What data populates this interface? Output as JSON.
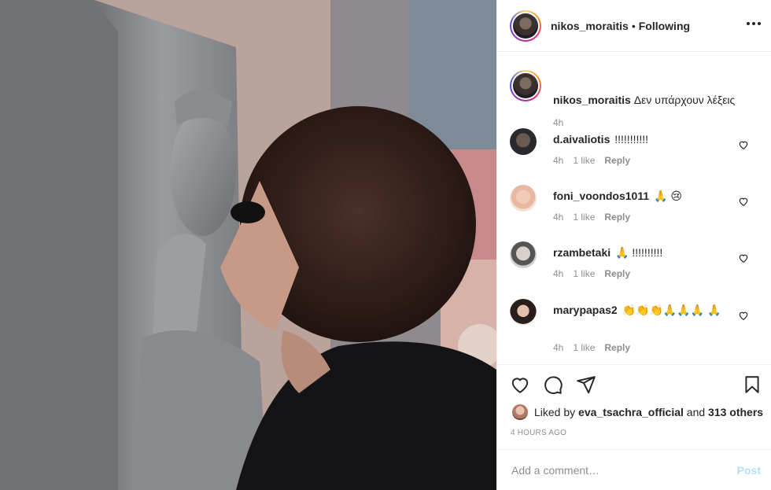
{
  "post": {
    "username": "nikos_moraitis",
    "separator": "•",
    "follow_status": "Following",
    "caption": "Δεν υπάρχουν λέξεις",
    "caption_time": "4h"
  },
  "comments": [
    {
      "user": "d.aivaliotis",
      "text": "!!!!!!!!!!!",
      "time": "4h",
      "likes": "1 like",
      "reply": "Reply"
    },
    {
      "user": "foni_voondos1011",
      "text": "🙏 😢",
      "time": "4h",
      "likes": "1 like",
      "reply": "Reply"
    },
    {
      "user": "rzambetaki",
      "text": "🙏 !!!!!!!!!!",
      "time": "4h",
      "likes": "1 like",
      "reply": "Reply"
    },
    {
      "user": "marypapas2",
      "text": "👏👏👏🙏🙏🙏 🙏",
      "time": "4h",
      "likes": "1 like",
      "reply": "Reply"
    }
  ],
  "likes": {
    "prefix": "Liked by",
    "user": "eva_tsachra_official",
    "and": "and",
    "others": "313 others"
  },
  "timestamp": "4 HOURS AGO",
  "comment_box": {
    "placeholder": "Add a comment…",
    "post_label": "Post"
  },
  "colors": {
    "text": "#262626",
    "muted": "#8e8e8e",
    "divider": "#efefef",
    "post_disabled": "#b2dffc"
  },
  "icons": [
    "more-icon",
    "heart-icon",
    "comment-icon",
    "share-icon",
    "bookmark-icon"
  ]
}
